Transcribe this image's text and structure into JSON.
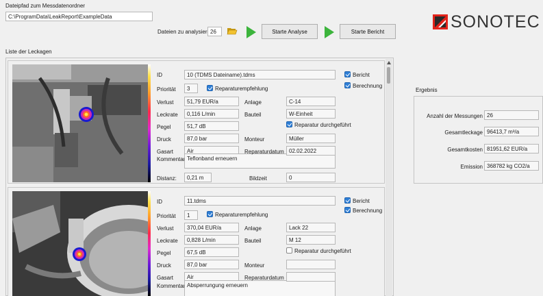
{
  "header": {
    "path_label": "Dateipfad zum Messdatenordner",
    "path_value": "C:\\ProgramData\\LeakReport\\ExampleData",
    "files_label": "Dateien zu analysieren",
    "files_count": "26",
    "start_analysis": "Starte Analyse",
    "start_report": "Starte Bericht",
    "logo_text": "SONOTEC"
  },
  "list_title": "Liste der Leckagen",
  "labels": {
    "id": "ID",
    "priority": "Priorität",
    "loss": "Verlust",
    "leakrate": "Leckrate",
    "level": "Pegel",
    "pressure": "Druck",
    "gas": "Gasart",
    "comment": "Kommentar",
    "distance": "Distanz:",
    "imagetime": "Bildzeit",
    "plant": "Anlage",
    "component": "Bauteil",
    "fitter": "Monteur",
    "repairdate": "Reparaturdatum",
    "repair_rec": "Reparaturempfehlung",
    "repair_done": "Reparatur durchgeführt",
    "report": "Bericht",
    "calculation": "Berechnung"
  },
  "leaks": [
    {
      "id": "10 (TDMS Dateiname).tdms",
      "priority": "3",
      "loss": "51,79 EUR/a",
      "leakrate": "0,116 L/min",
      "level": "51,7 dB",
      "pressure": "87,0 bar",
      "gas": "Air",
      "comment": "Teflonband erneuern",
      "distance": "0,21 m",
      "imagetime": "0",
      "plant": "C-14",
      "component": "W-Einheit",
      "fitter": "Müller",
      "repairdate": "02.02.2022"
    },
    {
      "id": "11.tdms",
      "priority": "1",
      "loss": "370,04 EUR/a",
      "leakrate": "0,828 L/min",
      "level": "67,5 dB",
      "pressure": "87,0 bar",
      "gas": "Air",
      "comment": "Absperrungung erneuern",
      "plant": "Lack 22",
      "component": "M 12",
      "fitter": "",
      "repairdate": ""
    }
  ],
  "results": {
    "title": "Ergebnis",
    "measurements_label": "Anzahl der Messungen",
    "measurements_value": "26",
    "total_leak_label": "Gesamtleckage",
    "total_leak_value": "96413,7 m³/a",
    "total_cost_label": "Gesamtkosten",
    "total_cost_value": "81951,62 EUR/a",
    "emission_label": "Emission",
    "emission_value": "368782 kg CO2/a"
  },
  "colors": {
    "accent_green": "#3cb43c",
    "checkbox_blue": "#2f7fd6",
    "logo_red": "#e2231a"
  }
}
